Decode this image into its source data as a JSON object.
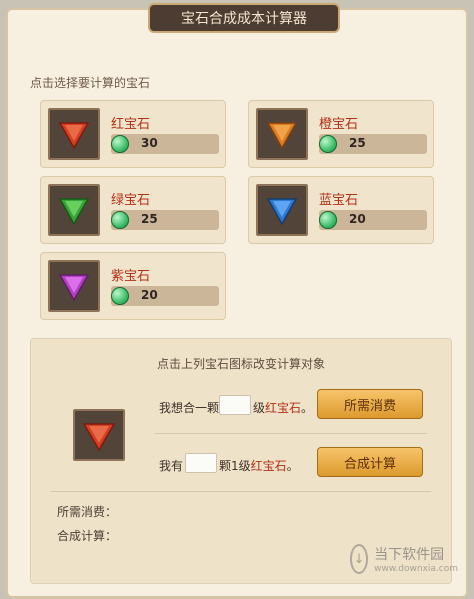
{
  "header": {
    "title": "宝石合成成本计算器"
  },
  "gem_section": {
    "title": "点击选择要计算的宝石",
    "gems": [
      {
        "name": "红宝石",
        "cost": "30",
        "icon": "red-gem-icon",
        "color": "#d63e22"
      },
      {
        "name": "橙宝石",
        "cost": "25",
        "icon": "orange-gem-icon",
        "color": "#e07d1f"
      },
      {
        "name": "绿宝石",
        "cost": "25",
        "icon": "green-gem-icon",
        "color": "#37a335"
      },
      {
        "name": "蓝宝石",
        "cost": "20",
        "icon": "blue-gem-icon",
        "color": "#2d78d2"
      },
      {
        "name": "紫宝石",
        "cost": "20",
        "icon": "purple-gem-icon",
        "color": "#b63ec7"
      }
    ]
  },
  "calc_panel": {
    "title": "点击上列宝石图标改变计算对象",
    "selected_gem": "红宝石",
    "line1_prefix": "我想合一颗",
    "line1_suffix_level": "级",
    "line1_suffix_gem": "红宝石",
    "line1_end": "。",
    "line2_prefix": "我有",
    "line2_suffix": "颗1级",
    "line2_gem": "红宝石",
    "line2_end": "。",
    "cost_button": "所需消费",
    "synth_button": "合成计算",
    "result_cost_label": "所需消费：",
    "result_synth_label": "合成计算："
  },
  "watermark": {
    "logo": "↓",
    "main": "当下软件园",
    "sub": "www.downxia.com"
  }
}
